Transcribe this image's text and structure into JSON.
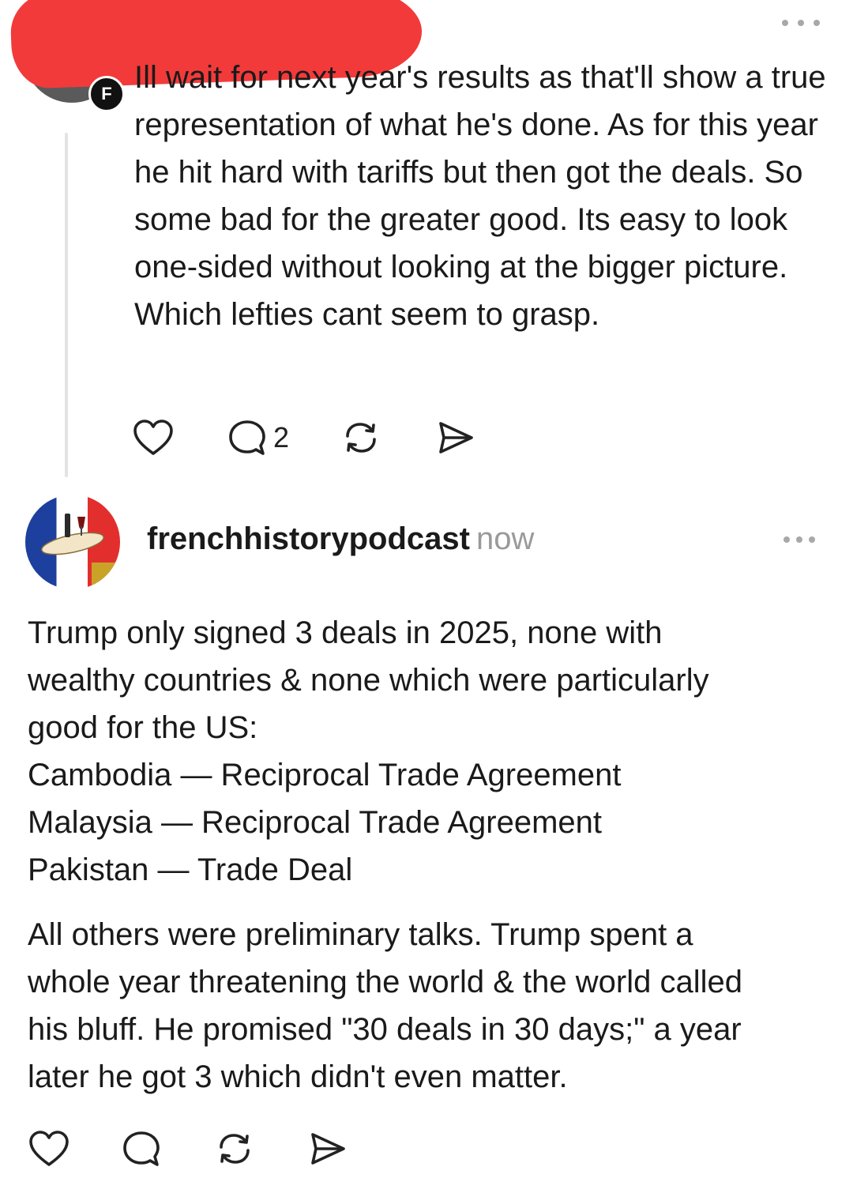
{
  "reply": {
    "text": "Ill wait for next year's results as that'll show a true representation of what he's done. As for this year he hit hard with tariffs but then got the deals. So some bad for the greater good. Its easy to look one-sided without looking at the bigger picture. Which lefties cant seem to grasp.",
    "badge_letter": "F",
    "reply_count": "2",
    "redaction_color": "#f23a3a"
  },
  "post": {
    "username": "frenchhistorypodcast",
    "timestamp": "now",
    "paragraph1_lines": [
      "Trump only signed 3 deals in 2025, none with",
      "wealthy countries & none which were particularly",
      "good for the US:",
      "Cambodia — Reciprocal Trade Agreement",
      "Malaysia — Reciprocal Trade Agreement",
      "Pakistan — Trade Deal"
    ],
    "paragraph2_lines": [
      "All others were preliminary talks. Trump spent a",
      "whole year threatening the world & the world called",
      "his bluff. He promised \"30 deals in 30 days;\" a year",
      "later he got 3 which didn't even matter."
    ]
  },
  "icons": {
    "like": "heart-icon",
    "comment": "comment-bubble-icon",
    "repost": "repost-icon",
    "share": "send-icon",
    "more": "more-options-icon"
  },
  "colors": {
    "text": "#1a1a1a",
    "muted": "#9a9a9a",
    "thread_line": "#e3e3e3",
    "flag_blue": "#1d3f9e",
    "flag_red": "#e32e2e"
  }
}
